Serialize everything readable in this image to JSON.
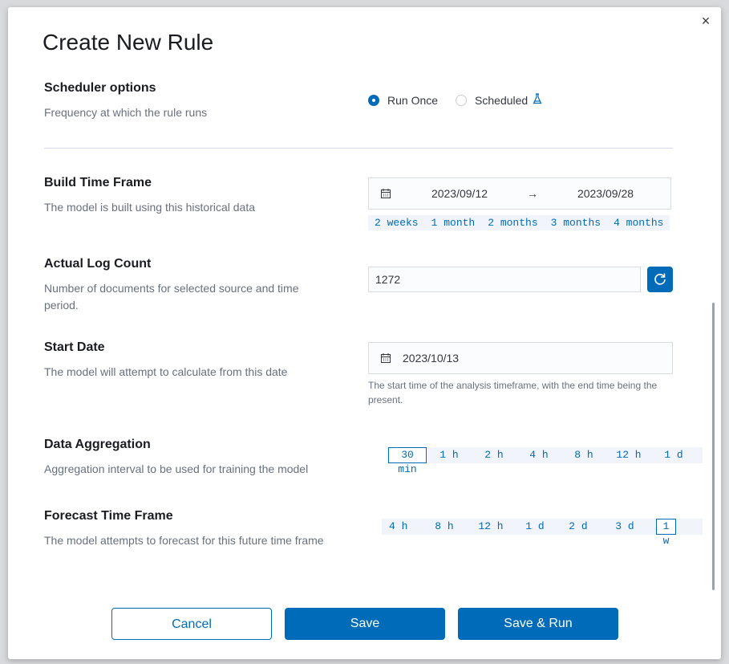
{
  "modal": {
    "title": "Create New Rule",
    "close_icon": "×"
  },
  "scheduler": {
    "title": "Scheduler options",
    "desc": "Frequency at which the rule runs",
    "options": [
      {
        "label": "Run Once",
        "selected": true
      },
      {
        "label": "Scheduled",
        "selected": false,
        "icon": "beaker-icon"
      }
    ]
  },
  "build_time_frame": {
    "title": "Build Time Frame",
    "desc": "The model is built using this historical data",
    "start": "2023/09/12",
    "arrow": "→",
    "end": "2023/09/28",
    "quick_ranges": [
      "2 weeks",
      "1 month",
      "2 months",
      "3 months",
      "4 months"
    ]
  },
  "log_count": {
    "title": "Actual Log Count",
    "desc": "Number of documents for selected source and time period.",
    "value": "1272"
  },
  "start_date": {
    "title": "Start Date",
    "desc": "The model will attempt to calculate from this date",
    "value": "2023/10/13",
    "help": "The start time of the analysis timeframe, with the end time being the present."
  },
  "aggregation": {
    "title": "Data Aggregation",
    "desc": "Aggregation interval to be used for training the model",
    "options": [
      "30 min",
      "1 h",
      "2 h",
      "4 h",
      "8 h",
      "12 h",
      "1 d"
    ],
    "selected": "30 min"
  },
  "forecast": {
    "title": "Forecast Time Frame",
    "desc": "The model attempts to forecast for this future time frame",
    "options": [
      "4 h",
      "8 h",
      "12 h",
      "1 d",
      "2 d",
      "3 d",
      "1 w"
    ],
    "selected": "1 w"
  },
  "footer": {
    "cancel": "Cancel",
    "save": "Save",
    "save_run": "Save & Run"
  },
  "colors": {
    "primary": "#006bb8",
    "text": "#343741",
    "subdued": "#69707d"
  }
}
